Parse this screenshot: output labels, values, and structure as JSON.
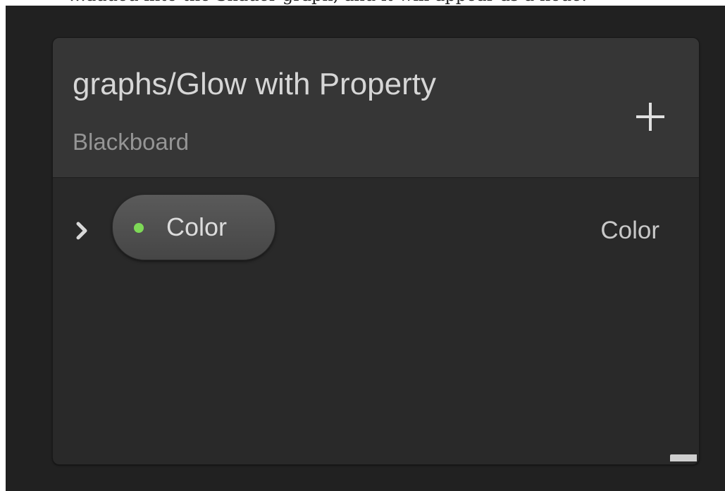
{
  "doc_snippet": "…added into the Shader graph, and it will appear as a node.",
  "blackboard": {
    "title": "graphs/Glow with Property",
    "subtitle": "Blackboard",
    "add_button": {
      "label": "+",
      "icon": "plus-icon"
    },
    "properties": [
      {
        "name": "Color",
        "type": "Color",
        "expanded": false,
        "indicator_color": "#7ed957"
      }
    ]
  },
  "colors": {
    "canvas": "#212121",
    "panel": "#292929",
    "header": "#363636",
    "accent_dot": "#7ed957"
  }
}
